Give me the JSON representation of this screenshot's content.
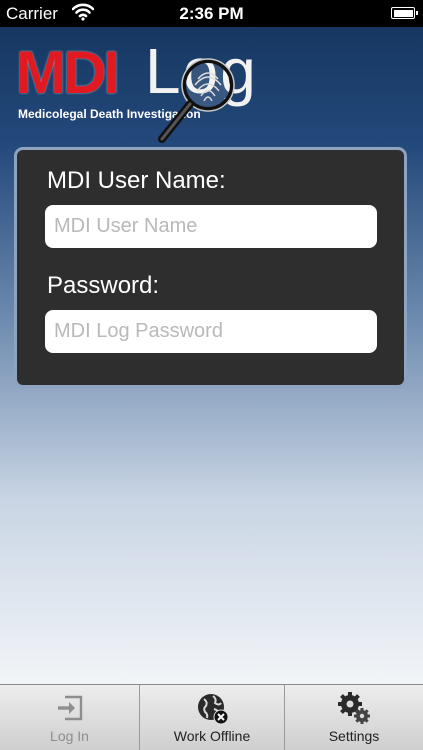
{
  "status_bar": {
    "carrier": "Carrier",
    "time": "2:36 PM",
    "battery_level": 1.0
  },
  "logo": {
    "mdi": "MDI",
    "log": "Log",
    "subtitle": "Medicolegal Death Investigation"
  },
  "login": {
    "username_label": "MDI User Name:",
    "username_placeholder": "MDI User Name",
    "username_value": "",
    "password_label": "Password:",
    "password_placeholder": "MDI Log Password",
    "password_value": ""
  },
  "tab_bar": {
    "login_label": "Log In",
    "offline_label": "Work Offline",
    "settings_label": "Settings"
  },
  "colors": {
    "brand_red": "#e11a22",
    "panel_bg": "#2e2e2e",
    "panel_border": "#8ea3bf",
    "background_top": "#163761",
    "background_bottom": "#f2f5f8"
  },
  "icons": {
    "status": [
      "wifi-icon",
      "battery-icon"
    ],
    "logo": "magnifier-fingerprint-icon",
    "tabs": [
      "login-arrow-icon",
      "globe-offline-icon",
      "gears-icon"
    ]
  }
}
